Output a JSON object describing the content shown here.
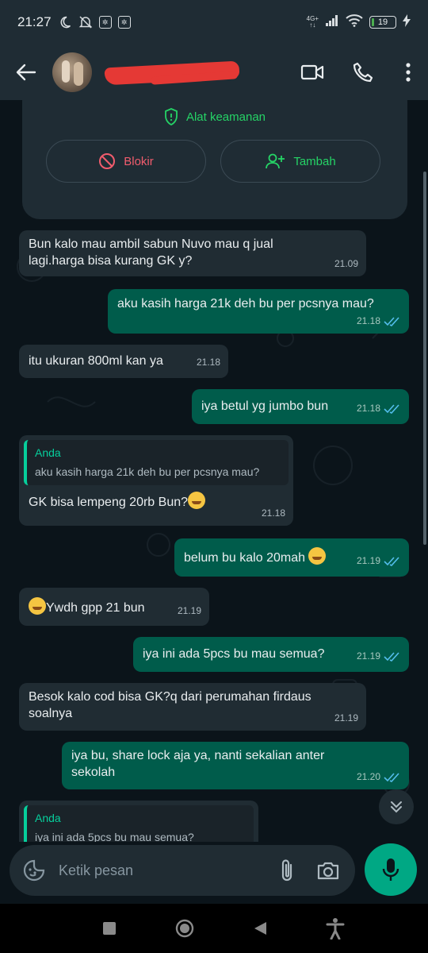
{
  "status_bar": {
    "time": "21:27",
    "network": "4G+",
    "battery": "19"
  },
  "header": {
    "contact_name": "",
    "icons": [
      "back-arrow-icon",
      "video-call-icon",
      "voice-call-icon",
      "more-vertical-icon"
    ]
  },
  "security_card": {
    "label": "Alat keamanan",
    "block_label": "Blokir",
    "add_label": "Tambah"
  },
  "messages": [
    {
      "dir": "in",
      "text_line1": "Bun kalo mau ambil sabun Nuvo mau q jual",
      "text_line2": "lagi.harga bisa kurang GK y?",
      "time": "21.09"
    },
    {
      "dir": "out",
      "text": "aku kasih harga 21k deh bu per pcsnya mau?",
      "time": "21.18"
    },
    {
      "dir": "in",
      "text": "itu ukuran 800ml kan ya",
      "time": "21.18"
    },
    {
      "dir": "out",
      "text": "iya betul yg jumbo bun",
      "time": "21.18"
    },
    {
      "dir": "in",
      "quote_author": "Anda",
      "quote_text": "aku kasih harga 21k deh bu per pcsnya mau?",
      "text": "GK bisa lempeng 20rb Bun?",
      "time": "21.18"
    },
    {
      "dir": "out",
      "text": "belum bu kalo 20mah",
      "time": "21.19"
    },
    {
      "dir": "in",
      "text": "Ywdh gpp 21 bun",
      "time": "21.19"
    },
    {
      "dir": "out",
      "text": "iya ini ada 5pcs bu mau semua?",
      "time": "21.19"
    },
    {
      "dir": "in",
      "text_line1": "Besok kalo cod bisa GK?q dari perumahan firdaus",
      "text_line2": "soalnya",
      "time": "21.19"
    },
    {
      "dir": "out",
      "text_line1": "iya bu, share lock aja ya, nanti sekalian anter",
      "text_line2": "sekolah",
      "time": "21.20"
    },
    {
      "dir": "in",
      "quote_author": "Anda",
      "quote_text": "iya ini ada 5pcs bu mau semua?"
    }
  ],
  "input": {
    "placeholder": "Ketik pesan"
  },
  "colors": {
    "accent": "#25d366",
    "outgoing_bubble": "#005c4b",
    "incoming_bubble": "#202c33",
    "danger": "#f15c6d",
    "read_ticks": "#53bdeb"
  }
}
